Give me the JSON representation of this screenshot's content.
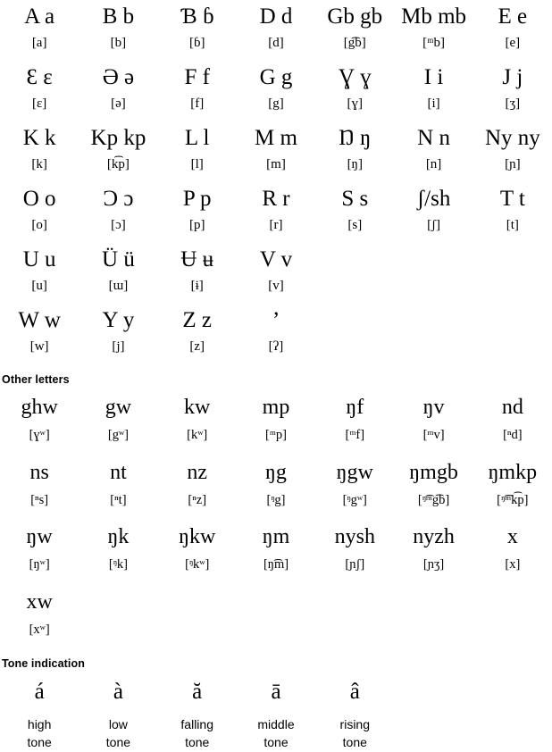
{
  "sections": {
    "alphabet": {
      "rows": [
        {
          "letters": [
            "A a",
            "B b",
            "Ɓ ɓ",
            "D d",
            "Gb gb",
            "Mb mb",
            "E e",
            "Ɛ ɛ"
          ],
          "ipa": [
            "[a]",
            "[b]",
            "[ɓ]",
            "[d]",
            "[g͡b]",
            "[ᵐb]",
            "[e]",
            "[ɛ]"
          ]
        },
        {
          "letters": [
            "Ə ə",
            "F f",
            "G g",
            "Ɣ ɣ",
            "I i",
            "J j",
            "K k",
            "Kp kp"
          ],
          "ipa": [
            "[ə]",
            "[f]",
            "[g]",
            "[ɣ]",
            "[i]",
            "[ʒ]",
            "[k]",
            "[k͡p]"
          ]
        },
        {
          "letters": [
            "L l",
            "M m",
            "Ŋ ŋ",
            "N n",
            "Ny ny",
            "O o",
            "Ɔ ɔ",
            "P p"
          ],
          "ipa": [
            "[l]",
            "[m]",
            "[ŋ]",
            "[n]",
            "[ɲ]",
            "[o]",
            "[ɔ]",
            "[p]"
          ]
        },
        {
          "letters": [
            "R r",
            "S s",
            "ʃ/sh",
            "T t",
            "U u",
            "Ü ü",
            "Ʉ ʉ",
            "V v"
          ],
          "ipa": [
            "[r]",
            "[s]",
            "[ʃ]",
            "[t]",
            "[u]",
            "[ɯ]",
            "[ɨ]",
            "[v]"
          ]
        },
        {
          "letters": [
            "W w",
            "Y y",
            "Z z",
            "’",
            "",
            "",
            "",
            ""
          ],
          "ipa": [
            "[w]",
            "[j]",
            "[z]",
            "[ʔ]",
            "",
            "",
            "",
            ""
          ]
        }
      ]
    },
    "other_letters": {
      "title": "Other letters",
      "rows": [
        {
          "letters": [
            "ghw",
            "gw",
            "kw",
            "mp",
            "ŋf",
            "ŋv",
            "nd",
            "ns"
          ],
          "ipa": [
            "[ɣʷ]",
            "[gʷ]",
            "[kʷ]",
            "[ᵐp]",
            "[ᵐf]",
            "[ᵐv]",
            "[ⁿd]",
            "[ⁿs]"
          ]
        },
        {
          "letters": [
            "nt",
            "nz",
            "ŋg",
            "ŋgw",
            "ŋmgb",
            "ŋmkp",
            "ŋw",
            "ŋk"
          ],
          "ipa": [
            "[ⁿt]",
            "[ⁿz]",
            "[ᵑg]",
            "[ᵑgʷ]",
            "[ᵑ͡ᵐg͡b]",
            "[ᵑ͡ᵐk͡p]",
            "[ŋʷ]",
            "[ᵑk]"
          ]
        },
        {
          "letters": [
            "ŋkw",
            "ŋm",
            "nysh",
            "nyzh",
            "x",
            "xw",
            "",
            ""
          ],
          "ipa": [
            "[ᵑkʷ]",
            "[ŋ͡m]",
            "[ɲʃ]",
            "[ɲʒ]",
            "[x]",
            "[xʷ]",
            "",
            ""
          ]
        }
      ]
    },
    "tone_indication": {
      "title": "Tone indication",
      "marks": [
        "á",
        "à",
        "ă",
        "ā",
        "â",
        "",
        ""
      ],
      "names": [
        "high\ntone",
        "low\ntone",
        "falling\ntone",
        "middle\ntone",
        "rising\ntone",
        "",
        ""
      ]
    }
  }
}
